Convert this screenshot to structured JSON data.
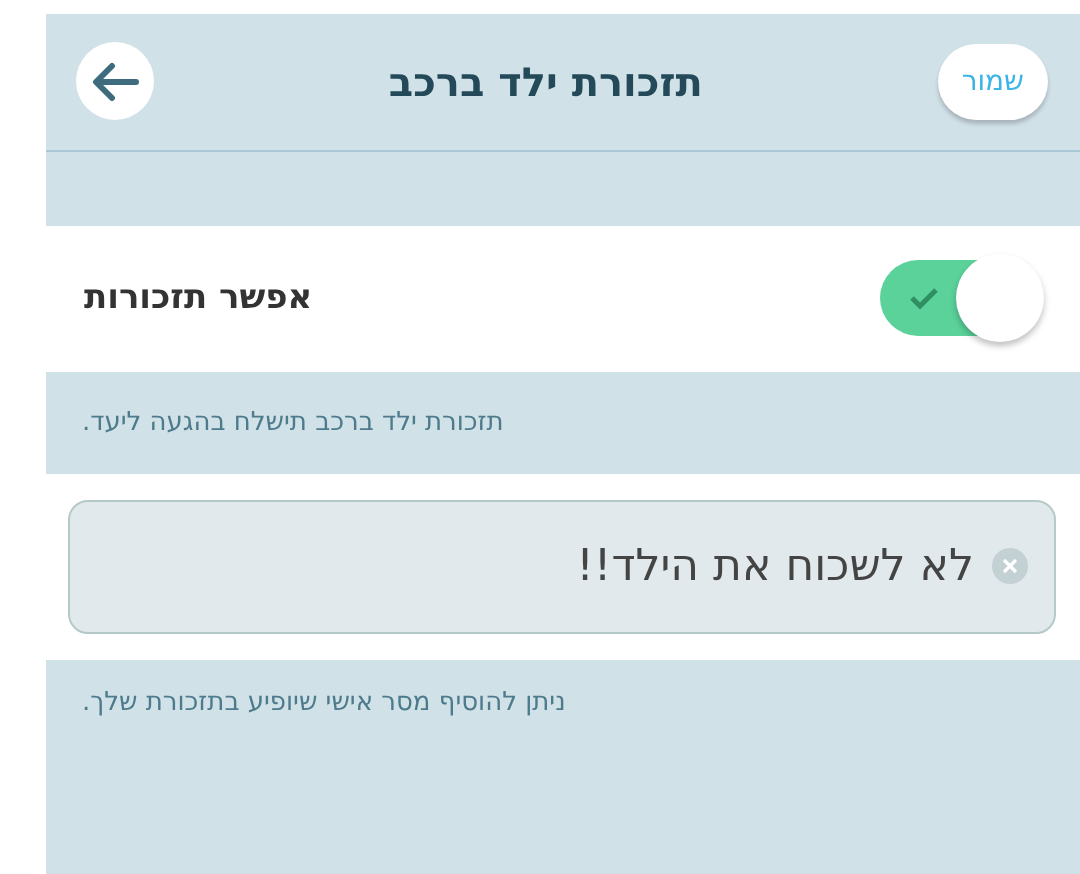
{
  "header": {
    "title": "תזכורת ילד ברכב",
    "save_button": "שמור"
  },
  "reminder_toggle": {
    "label": "אפשר תזכורות",
    "on": true
  },
  "toggle_note": "תזכורת ילד ברכב תישלח בהגעה ליעד.",
  "message_field": {
    "value": "לא לשכוח את הילד!!"
  },
  "message_note": "ניתן להוסיף מסר אישי שיופיע בתזכורת שלך."
}
